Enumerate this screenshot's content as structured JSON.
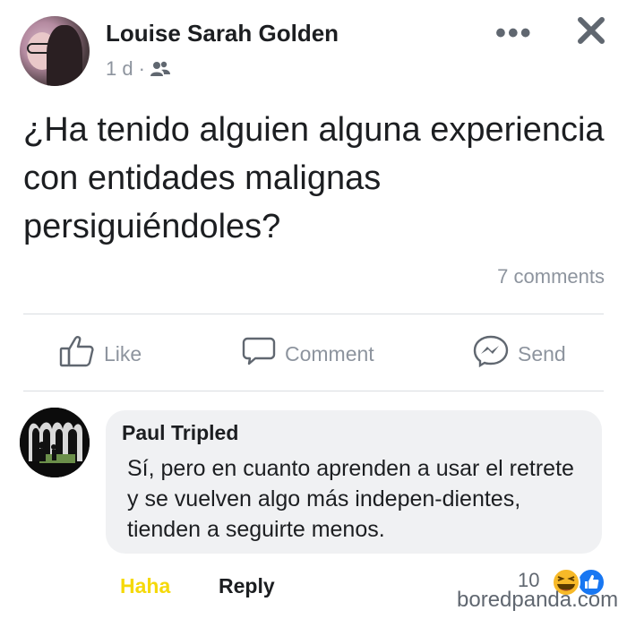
{
  "post": {
    "author": "Louise Sarah Golden",
    "time": "1 d",
    "separator": "·",
    "audience_icon": "friends-icon",
    "more_label": "•••",
    "text": "¿Ha tenido alguien alguna experiencia con entidades malignas persiguiéndoles?",
    "comments_count": "7 comments"
  },
  "actions": {
    "like": "Like",
    "comment": "Comment",
    "send": "Send"
  },
  "comment": {
    "author": "Paul Tripled",
    "text": "Sí, pero en cuanto aprenden a usar el retrete y se vuelven algo más indepen-dientes, tienden a seguirte menos.",
    "haha_label": "Haha",
    "reply_label": "Reply",
    "reaction_count": "10",
    "reactions": [
      "haha-icon",
      "like-icon"
    ]
  },
  "watermark": "boredpanda.com",
  "colors": {
    "haha": "#f5d90a",
    "like_blue": "#1877f2",
    "muted": "#8d949e"
  }
}
